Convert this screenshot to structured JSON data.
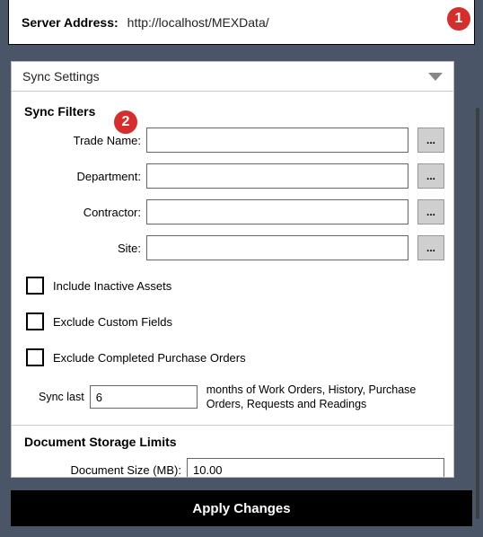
{
  "header": {
    "server_address_label": "Server Address:",
    "server_address_value": "http://localhost/MEXData/"
  },
  "badges": {
    "one": "1",
    "two": "2"
  },
  "sync": {
    "section_title": "Sync Settings",
    "filters_title": "Sync Filters",
    "rows": {
      "trade_name": {
        "label": "Trade Name:",
        "value": "",
        "browse": "..."
      },
      "department": {
        "label": "Department:",
        "value": "",
        "browse": "..."
      },
      "contractor": {
        "label": "Contractor:",
        "value": "",
        "browse": "..."
      },
      "site": {
        "label": "Site:",
        "value": "",
        "browse": "..."
      }
    },
    "checks": {
      "inactive_assets": "Include Inactive Assets",
      "exclude_custom": "Exclude Custom Fields",
      "exclude_completed_po": "Exclude Completed Purchase Orders"
    },
    "last": {
      "label": "Sync last",
      "value": "6",
      "desc": "months of Work Orders, History, Purchase Orders, Requests and Readings"
    }
  },
  "doc_limits": {
    "title": "Document Storage Limits",
    "size_label": "Document Size (MB):",
    "size_value": "10.00"
  },
  "apply_label": "Apply Changes"
}
